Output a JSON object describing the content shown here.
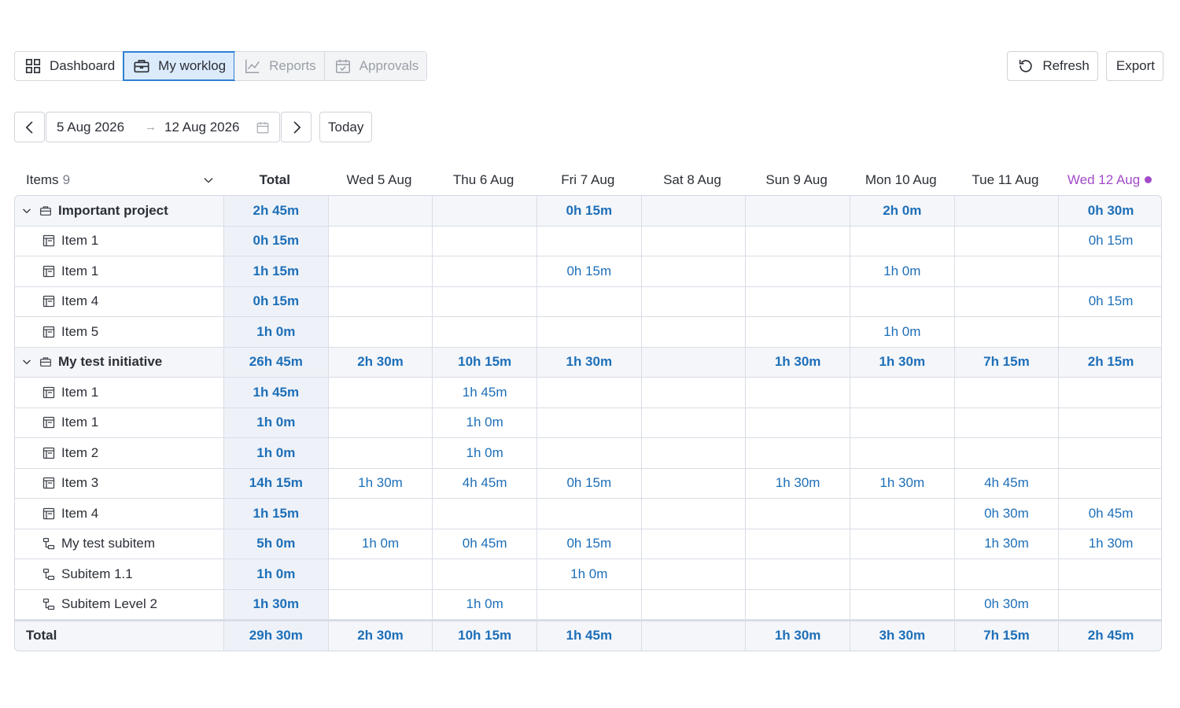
{
  "toolbar": {
    "tabs": [
      {
        "label": "Dashboard",
        "icon": "grid-icon",
        "state": "normal"
      },
      {
        "label": "My worklog",
        "icon": "briefcase-icon",
        "state": "active"
      },
      {
        "label": "Reports",
        "icon": "chart-icon",
        "state": "disabled"
      },
      {
        "label": "Approvals",
        "icon": "calendar-check-icon",
        "state": "disabled"
      }
    ],
    "refresh_label": "Refresh",
    "export_label": "Export"
  },
  "date_range": {
    "start": "5 Aug 2026",
    "arrow": "→",
    "end": "12 Aug 2026",
    "today_label": "Today"
  },
  "grid": {
    "items_label": "Items",
    "items_count": "9",
    "total_label": "Total",
    "days": [
      "Wed 5 Aug",
      "Thu 6 Aug",
      "Fri 7 Aug",
      "Sat 8 Aug",
      "Sun 9 Aug",
      "Mon 10 Aug",
      "Tue 11 Aug",
      "Wed 12 Aug"
    ],
    "today_index": 7,
    "rows": [
      {
        "type": "group",
        "name": "Important project",
        "total": "2h 45m",
        "values": [
          "",
          "",
          "0h 15m",
          "",
          "",
          "2h 0m",
          "",
          "0h 30m"
        ]
      },
      {
        "type": "item",
        "icon": "item-icon",
        "name": "Item 1",
        "total": "0h 15m",
        "values": [
          "",
          "",
          "",
          "",
          "",
          "",
          "",
          "0h 15m"
        ]
      },
      {
        "type": "item",
        "icon": "item-icon",
        "name": "Item 1",
        "total": "1h 15m",
        "values": [
          "",
          "",
          "0h 15m",
          "",
          "",
          "1h 0m",
          "",
          ""
        ]
      },
      {
        "type": "item",
        "icon": "item-icon",
        "name": "Item 4",
        "total": "0h 15m",
        "values": [
          "",
          "",
          "",
          "",
          "",
          "",
          "",
          "0h 15m"
        ]
      },
      {
        "type": "item",
        "icon": "item-icon",
        "name": "Item 5",
        "total": "1h 0m",
        "values": [
          "",
          "",
          "",
          "",
          "",
          "1h 0m",
          "",
          ""
        ]
      },
      {
        "type": "group",
        "name": "My test initiative",
        "total": "26h 45m",
        "values": [
          "2h 30m",
          "10h 15m",
          "1h 30m",
          "",
          "1h 30m",
          "1h 30m",
          "7h 15m",
          "2h 15m"
        ]
      },
      {
        "type": "item",
        "icon": "item-icon",
        "name": "Item 1",
        "total": "1h 45m",
        "values": [
          "",
          "1h 45m",
          "",
          "",
          "",
          "",
          "",
          ""
        ]
      },
      {
        "type": "item",
        "icon": "item-icon",
        "name": "Item 1",
        "total": "1h 0m",
        "values": [
          "",
          "1h 0m",
          "",
          "",
          "",
          "",
          "",
          ""
        ]
      },
      {
        "type": "item",
        "icon": "item-icon",
        "name": "Item 2",
        "total": "1h 0m",
        "values": [
          "",
          "1h 0m",
          "",
          "",
          "",
          "",
          "",
          ""
        ]
      },
      {
        "type": "item",
        "icon": "item-icon",
        "name": "Item 3",
        "total": "14h 15m",
        "values": [
          "1h 30m",
          "4h 45m",
          "0h 15m",
          "",
          "1h 30m",
          "1h 30m",
          "4h 45m",
          ""
        ]
      },
      {
        "type": "item",
        "icon": "item-icon",
        "name": "Item 4",
        "total": "1h 15m",
        "values": [
          "",
          "",
          "",
          "",
          "",
          "",
          "0h 30m",
          "0h 45m"
        ]
      },
      {
        "type": "item",
        "icon": "subitem-icon",
        "name": "My test subitem",
        "total": "5h 0m",
        "values": [
          "1h 0m",
          "0h 45m",
          "0h 15m",
          "",
          "",
          "",
          "1h 30m",
          "1h 30m"
        ]
      },
      {
        "type": "item",
        "icon": "subitem-icon",
        "name": "Subitem 1.1",
        "total": "1h 0m",
        "values": [
          "",
          "",
          "1h 0m",
          "",
          "",
          "",
          "",
          ""
        ]
      },
      {
        "type": "item",
        "icon": "subitem-icon",
        "name": "Subitem Level 2",
        "total": "1h 30m",
        "values": [
          "",
          "1h 0m",
          "",
          "",
          "",
          "",
          "0h 30m",
          ""
        ]
      }
    ],
    "footer": {
      "name": "Total",
      "total": "29h 30m",
      "values": [
        "2h 30m",
        "10h 15m",
        "1h 45m",
        "",
        "1h 30m",
        "3h 30m",
        "7h 15m",
        "2h 45m"
      ]
    }
  },
  "colors": {
    "accent": "#2f80d1",
    "value_text": "#1e6fb8",
    "today": "#a24bc9"
  }
}
